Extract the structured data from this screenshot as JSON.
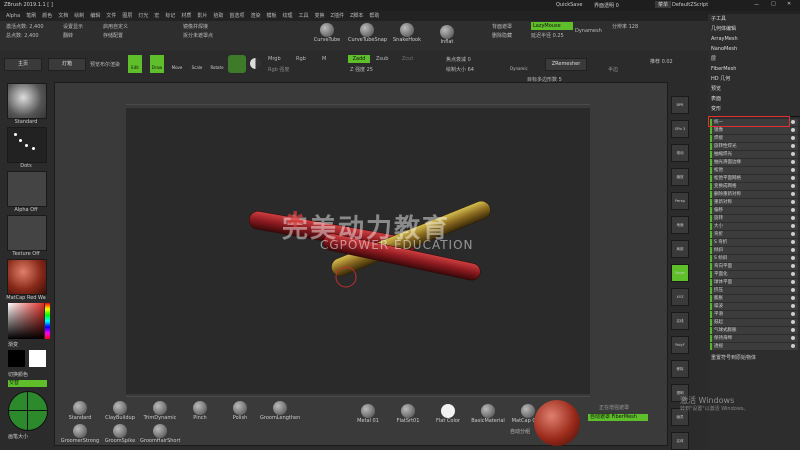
{
  "titlebar": {
    "title": "ZBrush 2019.1.1 [ ]",
    "quicksave": "QuickSave",
    "transparency": "界面透明 0",
    "menu_label": "菜单",
    "script": "DefaultZScript"
  },
  "menubar": [
    "Alpha",
    "笔刷",
    "颜色",
    "文档",
    "绘制",
    "编辑",
    "文件",
    "图层",
    "灯光",
    "宏",
    "标记",
    "材质",
    "影片",
    "拾取",
    "首选项",
    "渲染",
    "模板",
    "纹理",
    "工具",
    "变换",
    "Z插件",
    "Z脚本",
    "帮助"
  ],
  "top_controls": {
    "active_points": "激活点数: 2,400",
    "total_points": "总点数: 2,400",
    "btn_preset": "设置显示",
    "btn_flip": "翻转",
    "btn_custom": "启用自定义",
    "btn_store": "存储配置",
    "btn_mirror_weld": "镜像并焊接",
    "btn_split_unmask": "拆分未遮罩点",
    "brushes": [
      "CurveTube",
      "CurveTubeSnap",
      "SnakeHook",
      "Inflat"
    ],
    "btn_masking": "背面遮罩",
    "btn_delete_hidden": "删除隐藏",
    "lazy_mouse": "LazyMouse",
    "lazy_radius": "延迟半径 0.25",
    "dynamesh": "Dynamesh",
    "resolution": "分辨率 128",
    "smooth": "推荐 0.02"
  },
  "second_row": {
    "home": "主页",
    "light_box": "灯箱",
    "preview_label": "预览布尔渲染",
    "edit": "Edit",
    "draw": "Draw",
    "move": "Move",
    "scale": "Scale",
    "rotate": "Rotate",
    "mrgb": "Mrgb",
    "rgb": "Rgb",
    "m": "M",
    "zadd": "Zadd",
    "zsub": "Zsub",
    "zcut": "Zcut",
    "rgb_intensity": "Rgb 强度",
    "z_intensity": "Z 强度 25",
    "focal_shift": "焦点衰减 0",
    "draw_size": "绘制大小 64",
    "dynamic": "Dynamic",
    "zremesher": "ZRemesher",
    "target_poly": "目标多边形数 5",
    "half": "半边"
  },
  "left_shelf": {
    "standard": "Standard",
    "dots": "Dots",
    "alpha_off": "Alpha Off",
    "texture_off": "Texture Off",
    "matcap": "MatCap Red Wa",
    "gradient": "渐变",
    "switch_color": "切换颜色",
    "alternate": "交替",
    "brush_size": "画笔大小"
  },
  "right_shelf": [
    "BPR",
    "SPix 3",
    "滚动",
    "缩放",
    "Persp",
    "地面",
    "局部",
    "Move",
    "XYZ",
    "实线",
    "PolyF",
    "移除",
    "透明",
    "幽灵",
    "实体"
  ],
  "panel": {
    "items": [
      "子工具",
      "几何体编辑",
      "ArrayMesh",
      "NanoMesh",
      "层",
      "FiberMesh",
      "HD 几何",
      "预览",
      "表面",
      "变形"
    ],
    "deform_rows": [
      "统一",
      "镜像",
      "焊接",
      "旋转性焊光",
      "抽缩焊光",
      "抽光滑面边缘",
      "松弛",
      "松弛平面网格",
      "变换成网格",
      "删除重新对称",
      "重新对称",
      "偏移",
      "旋转",
      "大小",
      "弯折",
      "S 弯折",
      "倾斜",
      "S 倾斜",
      "弯向平面",
      "平面化",
      "球体平面",
      "挤压",
      "膨胀",
      "噪波",
      "平滑",
      "鼓起",
      "气球式膨胀",
      "保持海绵",
      "透视"
    ],
    "bottom": "重置符号到原始物体",
    "activate": "激活 Windows",
    "activate_sub": "转到\"设置\"以激活 Windows。"
  },
  "bottom_brushes": [
    "Standard",
    "ClayBuildup",
    "TrimDynamic",
    "Pinch",
    "Polish",
    "GroomLengthen",
    "GroomerStrong",
    "GroomSpike",
    "GroomHairShort"
  ],
  "bottom_materials": [
    "Metal 01",
    "FlatSrt01",
    "Flat Color",
    "BasicMaterial",
    "MatCap Gray"
  ],
  "bottom_misc": {
    "auto_mask": "自动遮罩 FiberMesh",
    "auto_group": "自动分组",
    "mask_label": "正在增强遮罩"
  },
  "watermark": {
    "cn": "完美动力教育",
    "en": "CGPOWER EDUCATION"
  },
  "colors": {
    "accent": "#5fbf2a",
    "highlight": "#e03030",
    "mesh": "#b0202a",
    "mesh_gold": "#a08a25"
  }
}
